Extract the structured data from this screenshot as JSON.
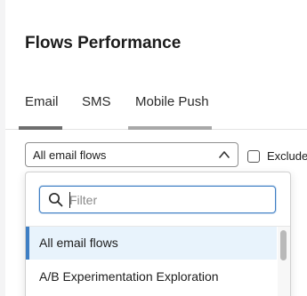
{
  "header": {
    "title": "Flows Performance"
  },
  "tabs": [
    {
      "label": "Email",
      "active": true
    },
    {
      "label": "SMS",
      "active": false
    },
    {
      "label": "Mobile Push",
      "active": false
    }
  ],
  "flow_select": {
    "value": "All email flows",
    "icon": "chevron-up-icon"
  },
  "exclude": {
    "label": "Exclude",
    "checked": false
  },
  "menu": {
    "filter": {
      "placeholder": "Filter",
      "value": "",
      "icon": "search-icon"
    },
    "options": [
      {
        "label": "All email flows",
        "selected": true
      },
      {
        "label": "A/B Experimentation Exploration",
        "selected": false
      }
    ]
  },
  "colors": {
    "accent": "#3f7fc4",
    "selected_bg": "#e8f3fc",
    "text": "#1c1c1c",
    "tab_underline": "#6e6e6e"
  }
}
